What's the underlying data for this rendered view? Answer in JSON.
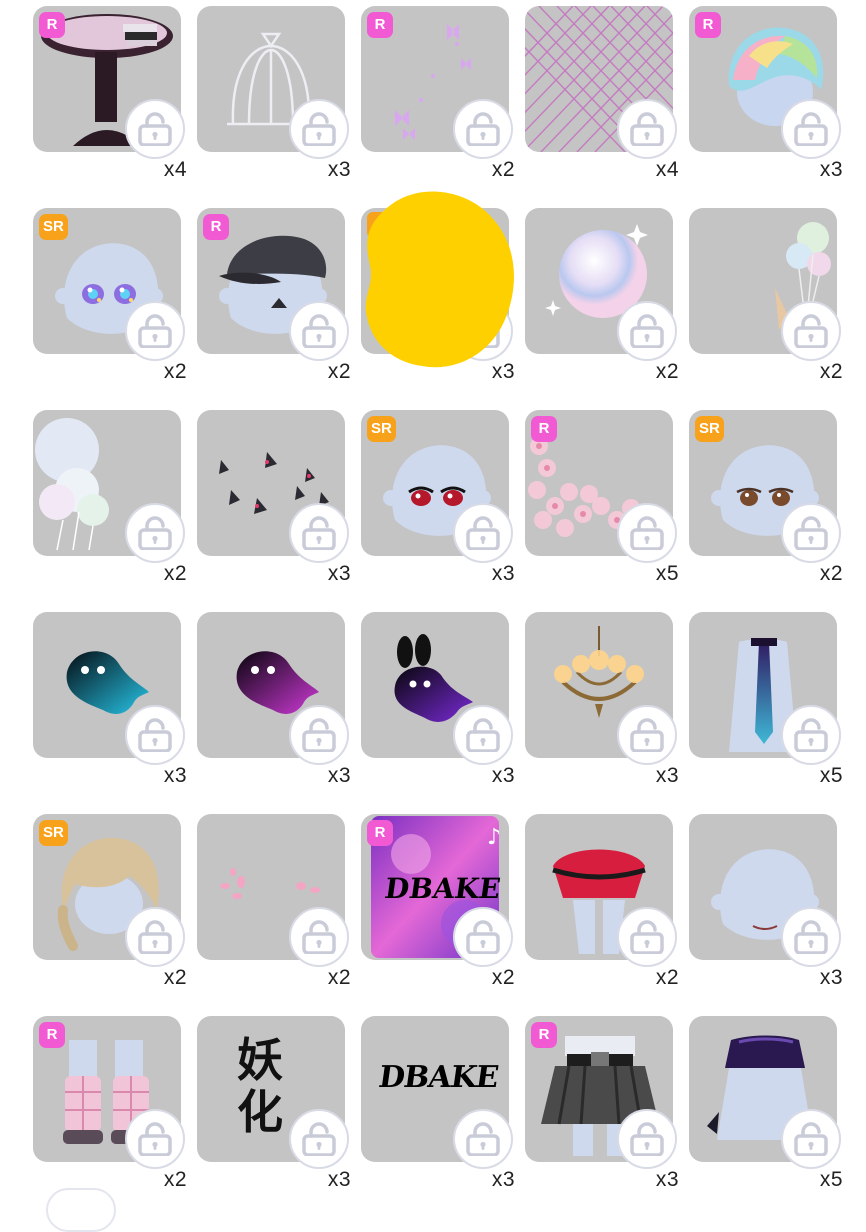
{
  "items": [
    {
      "rarity": "R",
      "count": "x4",
      "icon": "round-table-with-books-icon"
    },
    {
      "rarity": "",
      "count": "x3",
      "icon": "birdcage-icon"
    },
    {
      "rarity": "R",
      "count": "x2",
      "icon": "butterflies-icon"
    },
    {
      "rarity": "",
      "count": "x4",
      "icon": "diamond-lattice-icon"
    },
    {
      "rarity": "R",
      "count": "x3",
      "icon": "rainbow-hair-icon"
    },
    {
      "rarity": "SR",
      "count": "x2",
      "icon": "sparkly-eyes-face-icon"
    },
    {
      "rarity": "R",
      "count": "x2",
      "icon": "black-cap-icon"
    },
    {
      "rarity": "",
      "count": "x3",
      "icon": "scribbled-out-item-icon"
    },
    {
      "rarity": "",
      "count": "x2",
      "icon": "iridescent-bubble-icon"
    },
    {
      "rarity": "",
      "count": "x2",
      "icon": "balloons-icon"
    },
    {
      "rarity": "",
      "count": "x2",
      "icon": "iridescent-balloons-icon"
    },
    {
      "rarity": "",
      "count": "x3",
      "icon": "strawberries-icon"
    },
    {
      "rarity": "SR",
      "count": "x3",
      "icon": "red-eyes-face-icon"
    },
    {
      "rarity": "R",
      "count": "x5",
      "icon": "cherry-blossom-icon"
    },
    {
      "rarity": "SR",
      "count": "x2",
      "icon": "brown-eyes-face-icon"
    },
    {
      "rarity": "",
      "count": "x3",
      "icon": "cyan-ghost-icon"
    },
    {
      "rarity": "",
      "count": "x3",
      "icon": "pink-ghost-icon"
    },
    {
      "rarity": "",
      "count": "x3",
      "icon": "bunny-ghost-icon"
    },
    {
      "rarity": "",
      "count": "x3",
      "icon": "chandelier-icon"
    },
    {
      "rarity": "",
      "count": "x5",
      "icon": "galaxy-tie-shirt-icon"
    },
    {
      "rarity": "SR",
      "count": "x2",
      "icon": "blonde-braids-hair-icon"
    },
    {
      "rarity": "",
      "count": "x2",
      "icon": "pink-petals-icon"
    },
    {
      "rarity": "R",
      "count": "x2",
      "icon": "dbake-purple-background-icon"
    },
    {
      "rarity": "",
      "count": "x2",
      "icon": "red-ruffle-skirt-icon"
    },
    {
      "rarity": "",
      "count": "x3",
      "icon": "smile-face-icon"
    },
    {
      "rarity": "R",
      "count": "x2",
      "icon": "pink-plaid-boots-icon"
    },
    {
      "rarity": "",
      "count": "x3",
      "icon": "kanji-sticker-icon"
    },
    {
      "rarity": "",
      "count": "x3",
      "icon": "dbake-logo-icon"
    },
    {
      "rarity": "R",
      "count": "x3",
      "icon": "black-pleated-skirt-icon"
    },
    {
      "rarity": "",
      "count": "x5",
      "icon": "purple-crop-top-icon"
    }
  ],
  "dbake_text": "DBAKE",
  "kanji_text": "妖化",
  "colors": {
    "card_bg": "#c4c4c4",
    "badge_r": "#f25ad4",
    "badge_sr": "#f7a21a",
    "lock": "#d0d3df",
    "scribble": "#ffd000"
  }
}
